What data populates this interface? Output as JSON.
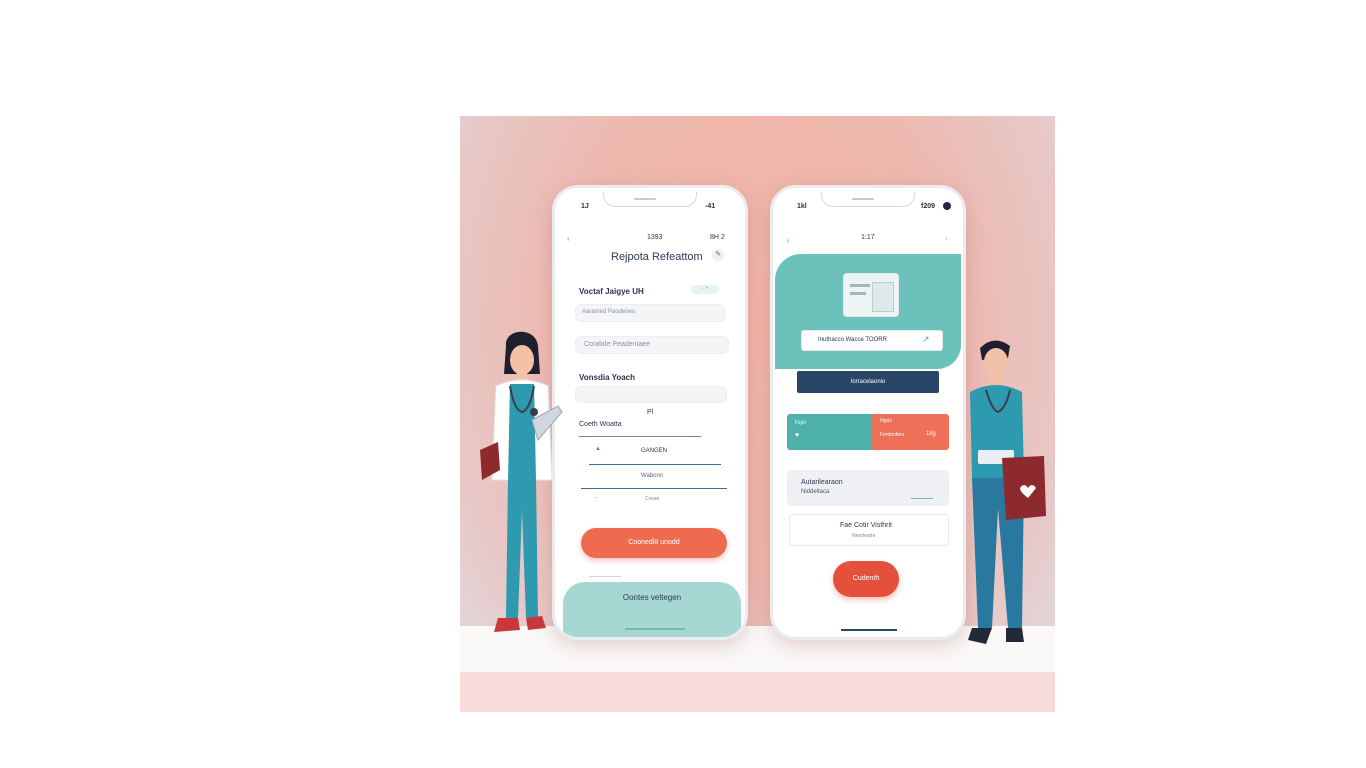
{
  "phone_left": {
    "status_time": "1J",
    "status_right": "-41",
    "top_number": "1393",
    "top_right": "8H 2",
    "title": "Rejpota Refeattom",
    "section_label": "Voctaf Jaigye UH",
    "field1_placeholder": "Aaramed Paodeneo",
    "field2_placeholder": "Coratide Peadentaee",
    "section2_label": "Vonsdia Yoach",
    "small_label": "Pl",
    "sub_label": "Coeth Woatta",
    "row1_text": "GANGEN",
    "row2_text": "Wabonn",
    "row3_text": "Cvean",
    "primary_button": "Coonedl8 unodd",
    "bottom_button": "Oontes veltegen"
  },
  "phone_right": {
    "status_time": "1kl",
    "status_right": "f209",
    "top_number": "1:17",
    "search_text": "Inuthacco Wacce TOORR",
    "dark_button": "Iorracelaonio",
    "card_left_label": "Figid",
    "card_right_label": "Ifigds",
    "card_right_sub": "Ferdenfers",
    "card_right_value": "1l/g",
    "info_title": "Autarilearaon",
    "info_sub": "Niddeltaca",
    "info2_title": "Fae Cotir Visthrit",
    "info2_sub": "Neodeatre",
    "round_button": "Cudenth"
  },
  "colors": {
    "coral": "#ee6b50",
    "teal": "#6cc1ba",
    "navy": "#2a4666",
    "scrubs": "#2d9ab0"
  }
}
